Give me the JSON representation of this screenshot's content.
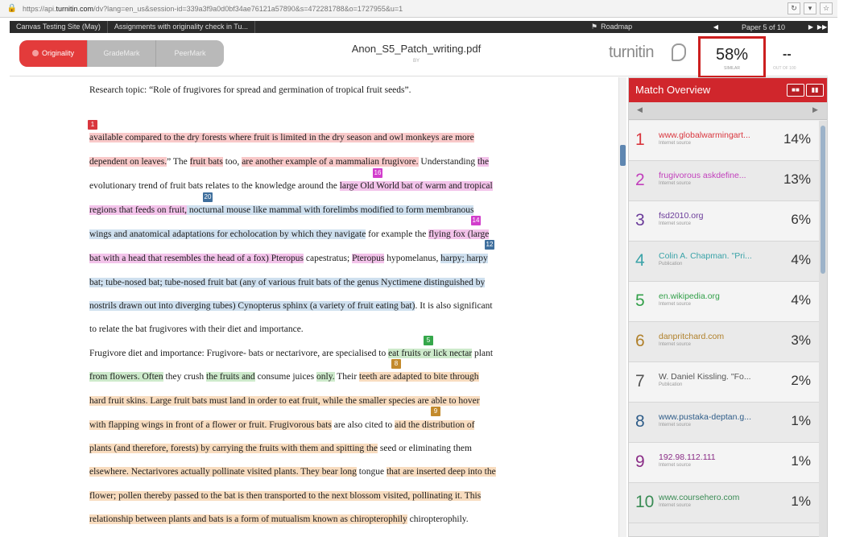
{
  "browser": {
    "url_prefix": "https://api.",
    "url_domain": "turnitin.com",
    "url_rest": "/dv?lang=en_us&session-id=339a3f9a0d0bf34ae76121a57890&s=472281788&o=1727955&u=1"
  },
  "topnav": {
    "site": "Canvas Testing Site (May)",
    "assignment": "Assignments with originality check in Tu...",
    "roadmap": "Roadmap",
    "paper": "Paper 5 of 10"
  },
  "modes": [
    "Originality",
    "GradeMark",
    "PeerMark"
  ],
  "document": {
    "filename": "Anon_S5_Patch_writing.pdf",
    "file_sub": "BY",
    "brand": "turnitin",
    "score": "58%",
    "score_label": "SIMILAR",
    "grade": "--",
    "grade_label": "OUT OF 100"
  },
  "tags": [
    "1",
    "16",
    "20",
    "14",
    "12",
    "5",
    "8",
    "9"
  ],
  "text": {
    "l1": "Research topic: “Role of frugivores for spread and germination of tropical fruit seeds”.",
    "l2": "available compared to the dry forests where fruit is limited in the dry season and owl monkeys are more",
    "l3a": "dependent on leaves.",
    "l3b": "” The ",
    "l3c": "fruit bats",
    "l3d": " too, ",
    "l3e": "are another example of a mammalian frugivore.",
    "l3f": " Understanding ",
    "l3g": "the",
    "l4a": "evolutionary trend of fruit bats relates to the knowledge around the ",
    "l4b": "large Old World bat of warm and tropical",
    "l5a": "regions that feeds on fruit,",
    "l5b": " nocturnal mouse like mammal with forelimbs modified to form membranous",
    "l6a": "wings and anatomical adaptations for echolocation by which they navigate",
    "l6b": " for example the ",
    "l6c": "flying fox (large",
    "l7a": "bat with a head that resembles the head of a fox) Pteropus",
    "l7b": " capestratus; ",
    "l7c": "Pteropus",
    "l7d": " hypomelanus, ",
    "l7e": "harpy; harpy",
    "l8": "bat; tube-nosed bat; tube-nosed fruit bat (any of various fruit bats of the genus Nyctimene distinguished by",
    "l9a": "nostrils drawn out into diverging tubes) Cynopterus sphinx (a variety of fruit eating bat)",
    "l9b": ". It is also significant",
    "l10": "to relate the bat frugivores with their diet and importance.",
    "l11a": "Frugivore diet and importance: Frugivore- bats or nectarivore, are specialised to ",
    "l11b": "eat fruits or lick nectar",
    "l11c": " plant",
    "l12a": "from flowers. Often",
    "l12b": " they crush ",
    "l12c": "the fruits and",
    "l12d": " consume juices ",
    "l12e": "only.",
    "l12f": " Their ",
    "l12g": "teeth are adapted to bite through",
    "l13": "hard fruit skins. Large fruit bats must land in order to eat fruit, while the smaller species are able to hover",
    "l14a": "with flapping wings in front of a flower or fruit. Frugivorous bats",
    "l14b": " are also cited to ",
    "l14c": "aid the distribution of",
    "l15a": "plants (and therefore, forests) by carrying the fruits with them and spitting the",
    "l15b": " seed or eliminating them",
    "l16a": "elsewhere. Nectarivores actually pollinate visited plants. They bear long",
    "l16b": " tongue ",
    "l16c": "that are inserted deep into the",
    "l17": "flower; pollen thereby passed to the bat is then transported to the next blossom visited, pollinating it. This",
    "l18a": "relationship between plants and bats is a form of mutualism known as chiropterophily",
    "l18b": " chiropterophily."
  },
  "panel": {
    "title": "Match Overview",
    "matches": [
      {
        "n": "1",
        "src": "www.globalwarmingart...",
        "type": "Internet source",
        "pct": "14%",
        "color": "#d9363e"
      },
      {
        "n": "2",
        "src": "frugivorous askdefine...",
        "type": "Internet source",
        "pct": "13%",
        "color": "#c23fbc"
      },
      {
        "n": "3",
        "src": "fsd2010.org",
        "type": "Internet source",
        "pct": "6%",
        "color": "#6b3c9a"
      },
      {
        "n": "4",
        "src": "Colin A. Chapman. \"Pri...",
        "type": "Publication",
        "pct": "4%",
        "color": "#3aa3a8"
      },
      {
        "n": "5",
        "src": "en.wikipedia.org",
        "type": "Internet source",
        "pct": "4%",
        "color": "#33a04a"
      },
      {
        "n": "6",
        "src": "danpritchard.com",
        "type": "Internet source",
        "pct": "3%",
        "color": "#b0802a"
      },
      {
        "n": "7",
        "src": "W. Daniel Kissling. \"Fo...",
        "type": "Publication",
        "pct": "2%",
        "color": "#555555"
      },
      {
        "n": "8",
        "src": "www.pustaka-deptan.g...",
        "type": "Internet source",
        "pct": "1%",
        "color": "#2f5d89"
      },
      {
        "n": "9",
        "src": "192.98.112.111",
        "type": "Internet source",
        "pct": "1%",
        "color": "#8a2c86"
      },
      {
        "n": "10",
        "src": "www.coursehero.com",
        "type": "Internet source",
        "pct": "1%",
        "color": "#3a8c55"
      }
    ]
  }
}
